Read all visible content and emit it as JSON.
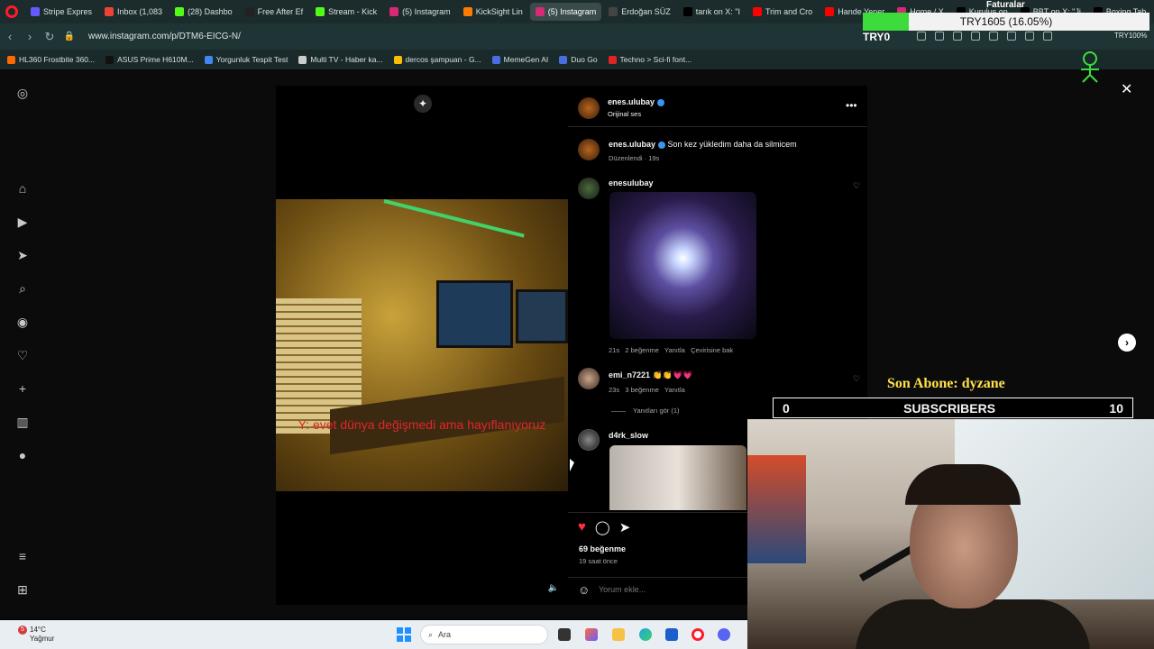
{
  "browser": {
    "tabs": [
      {
        "label": "Stripe Expres",
        "color": "#635bff"
      },
      {
        "label": "Inbox (1,083",
        "color": "#ea4335"
      },
      {
        "label": "(28) Dashbo",
        "color": "#53fc18"
      },
      {
        "label": "Free After Ef",
        "color": "#222222"
      },
      {
        "label": "Stream - Kick",
        "color": "#53fc18"
      },
      {
        "label": "(5) Instagram",
        "color": "#d62976"
      },
      {
        "label": "KickSight Lin",
        "color": "#ff7a00"
      },
      {
        "label": "(5) Instagram",
        "color": "#d62976",
        "active": true
      },
      {
        "label": "Erdoğan SÜZ",
        "color": "#444444"
      },
      {
        "label": "tarık on X: \"I",
        "color": "#000000"
      },
      {
        "label": "Trim and Cro",
        "color": "#ff0000"
      },
      {
        "label": "Hande Yener",
        "color": "#ff0000"
      },
      {
        "label": "Home / X",
        "color": "#d62976"
      },
      {
        "label": "Kuruluş on",
        "color": "#000000"
      },
      {
        "label": "BBT on X: \"Ji",
        "color": "#000000"
      },
      {
        "label": "Boxing Tab",
        "color": "#000000"
      }
    ],
    "url": "www.instagram.com/p/DTM6-EICG-N/",
    "bookmarks": [
      {
        "label": "HL360 Frostbite 360...",
        "color": "#ff6a00"
      },
      {
        "label": "ASUS Prime H610M...",
        "color": "#111111"
      },
      {
        "label": "Yorgunluk Tespit Test",
        "color": "#4285f4"
      },
      {
        "label": "Multi TV - Haber ka...",
        "color": "#cccccc"
      },
      {
        "label": "dercos şampuan - G...",
        "color": "#fbbc05"
      },
      {
        "label": "MemeGen AI",
        "color": "#4a6ee0"
      },
      {
        "label": "Duo Go",
        "color": "#4a6ee0"
      },
      {
        "label": "Techno > Sci-fi font...",
        "color": "#e02424"
      }
    ],
    "wallet_label": "TRY0",
    "wallet_right": "TRY100%"
  },
  "overlay": {
    "faturalar": "Faturalar",
    "try_progress": "TRY1605 (16.05%)",
    "try_progress_fraction": 0.1605,
    "son_abone": "Son Abone: dyzane",
    "subs_current": "0",
    "subs_label": "SUBSCRIBERS",
    "subs_goal": "10"
  },
  "post": {
    "caption_video": "Y: evet dünya değişmedi ama hayıflanıyoruz",
    "author": "enes.ulubay",
    "audio": "Orijinal ses",
    "comments": [
      {
        "user": "enes.ulubay",
        "text": "Son kez yükledim daha da silmicem",
        "meta": "Düzenlendi · 19s"
      },
      {
        "user": "enesulubay",
        "text": "",
        "meta_time": "21s",
        "meta_likes": "2 beğenme",
        "meta_reply": "Yanıtla",
        "meta_translate": "Çevirisine bak"
      },
      {
        "user": "emi_n7221",
        "text": "👏👏💗💗",
        "meta_time": "23s",
        "meta_likes": "3 beğenme",
        "meta_reply": "Yanıtla",
        "replies": "Yanıtları gör (1)"
      },
      {
        "user": "d4rk_slow",
        "text": ""
      }
    ],
    "likes": "69 beğenme",
    "time_ago": "19 saat önce",
    "comment_placeholder": "Yorum ekle..."
  },
  "taskbar": {
    "weather_temp": "14°C",
    "weather_desc": "Yağmur",
    "weather_badge": "5",
    "search_placeholder": "Ara"
  }
}
